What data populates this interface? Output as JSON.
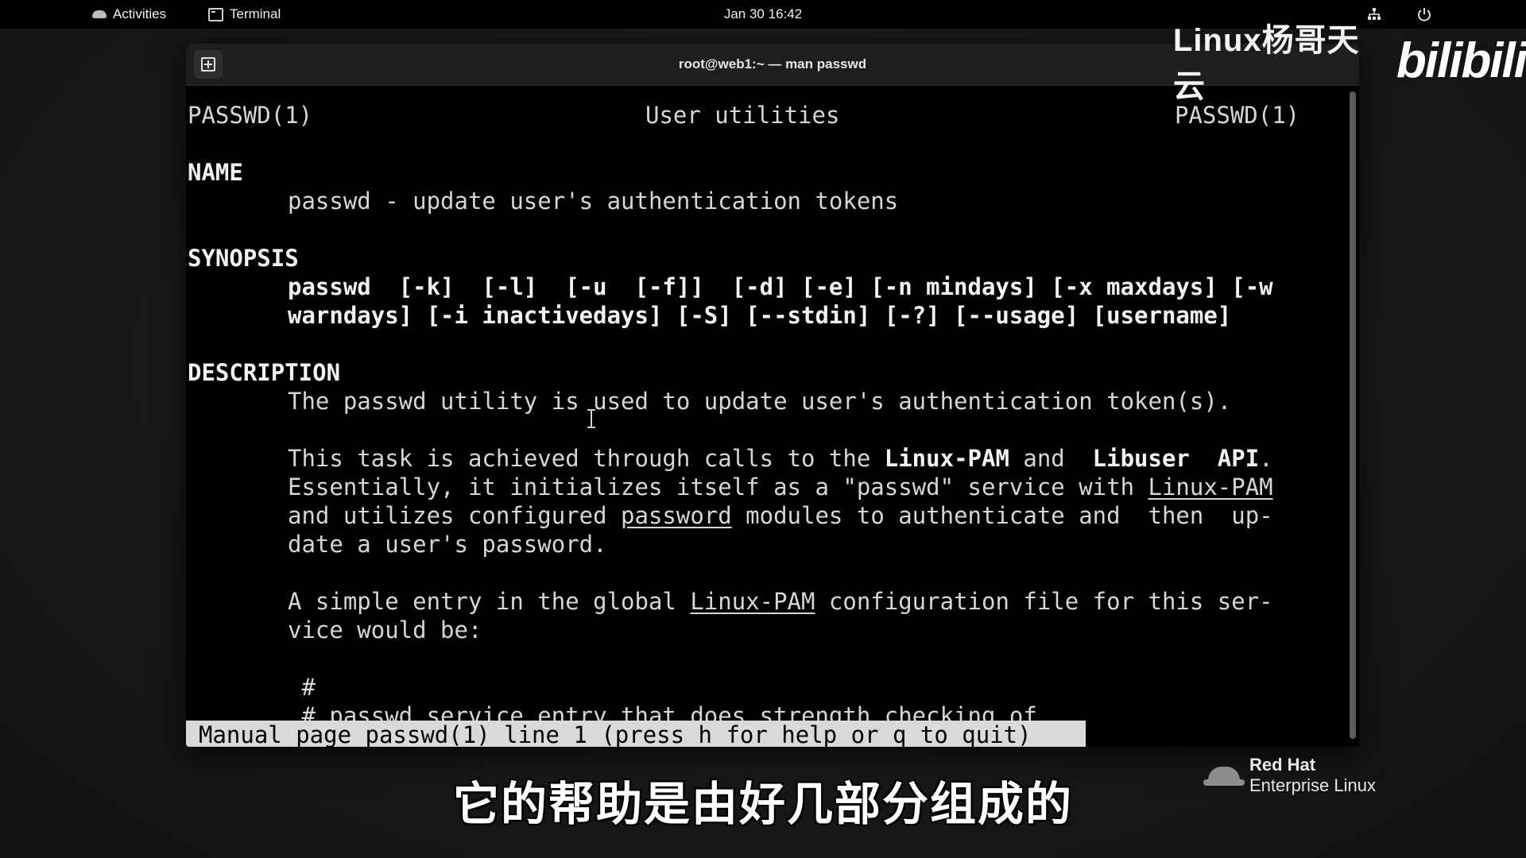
{
  "topbar": {
    "activities_label": "Activities",
    "app_label": "Terminal",
    "clock": "Jan 30  16:42",
    "icons": [
      "network-icon",
      "power-icon"
    ]
  },
  "window": {
    "title": "root@web1:~ — man passwd"
  },
  "man": {
    "header_left": "PASSWD(1)",
    "header_center": "User utilities",
    "header_right": "PASSWD(1)",
    "sections": {
      "name": "NAME",
      "synopsis": "SYNOPSIS",
      "description": "DESCRIPTION"
    },
    "name_line": "passwd - update user's authentication tokens",
    "synopsis_line1": "passwd  [-k]  [-l]  [-u  [-f]]  [-d] [-e] [-n mindays] [-x maxdays] [-w",
    "synopsis_line2": "warndays] [-i inactivedays] [-S] [--stdin] [-?] [--usage] [username]",
    "desc_p1": "The passwd utility is used to update user's authentication token(s).",
    "desc_p2_l1_a": "This task is achieved through calls to the ",
    "desc_p2_l1_b": "Linux-PAM",
    "desc_p2_l1_c": " and  ",
    "desc_p2_l1_d": "Libuser  API",
    "desc_p2_l1_e": ".",
    "desc_p2_l2_a": "Essentially, it initializes itself as a \"passwd\" service with ",
    "desc_p2_l2_b": "Linux-PAM",
    "desc_p2_l3_a": "and utilizes configured ",
    "desc_p2_l3_b": "password",
    "desc_p2_l3_c": " modules to authenticate and  then  up-",
    "desc_p2_l4": "date a user's password.",
    "desc_p3_l1_a": "A simple entry in the global ",
    "desc_p3_l1_b": "Linux-PAM",
    "desc_p3_l1_c": " configuration file for this ser-",
    "desc_p3_l2": "vice would be:",
    "code_l1": " #",
    "code_l2": " # passwd service entry that does strength checking of",
    "status": "Manual page passwd(1) line 1 (press h for help or q to quit)"
  },
  "overlay": {
    "channel_name": "Linux杨哥天云",
    "site_logo": "bilibili",
    "rh_brand": "Red Hat",
    "rh_product": "Enterprise Linux",
    "subtitle": "它的帮助是由好几部分组成的"
  }
}
